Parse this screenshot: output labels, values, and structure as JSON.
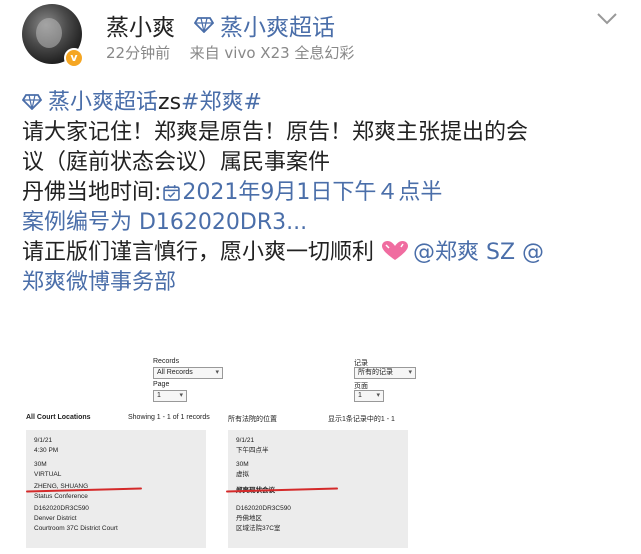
{
  "header": {
    "username": "蒸小爽",
    "topic_tag": "蒸小爽超话",
    "timestamp": "22分钟前",
    "source": "来自 vivo X23 全息幻彩",
    "badge": "v"
  },
  "post": {
    "lines": [
      {
        "topic": "蒸小爽超话",
        "text": "zs",
        "hashtag": "#郑爽#"
      },
      {
        "text": "请大家记住！郑爽是原告！原告！郑爽主张提出的会"
      },
      {
        "text": "议（庭前状态会议）属民事案件"
      },
      {
        "prefix": "丹佛当地时间:",
        "date_link": "2021年9月1日下午４点半"
      },
      {
        "case_link": "案例编号为 D162020DR3..."
      },
      {
        "text": "请正版们谨言慎行，愿小爽一切顺利",
        "mention1": "@郑爽 SZ",
        "mention2": "@"
      },
      {
        "mention_cont": "郑爽微博事务部"
      }
    ]
  },
  "screenshot_en": {
    "records_label": "Records",
    "records_value": "All Records",
    "page_label": "Page",
    "page_value": "1",
    "heading": "All Court Locations",
    "showing": "Showing 1 - 1 of 1 records",
    "record": [
      "9/1/21",
      "4:30 PM",
      "30M",
      "VIRTUAL",
      "ZHENG, SHUANG",
      "Status Conference",
      "D162020DR3C590",
      "Denver District",
      "Courtroom 37C District Court"
    ]
  },
  "screenshot_cn": {
    "records_label": "记录",
    "records_value": "所有的记录",
    "page_label": "页面",
    "page_value": "1",
    "heading": "所有法院的位置",
    "showing": "显示1条记录中的1 - 1",
    "record": [
      "9/1/21",
      "下午四点半",
      "30M",
      "虚拟",
      "郑爽现状会议",
      "",
      "D162020DR3C590",
      "丹佛地区",
      "区域法院37C室"
    ]
  },
  "colors": {
    "link": "#4a6ea9",
    "badge": "#f5a623",
    "underline": "#d42a2a"
  }
}
